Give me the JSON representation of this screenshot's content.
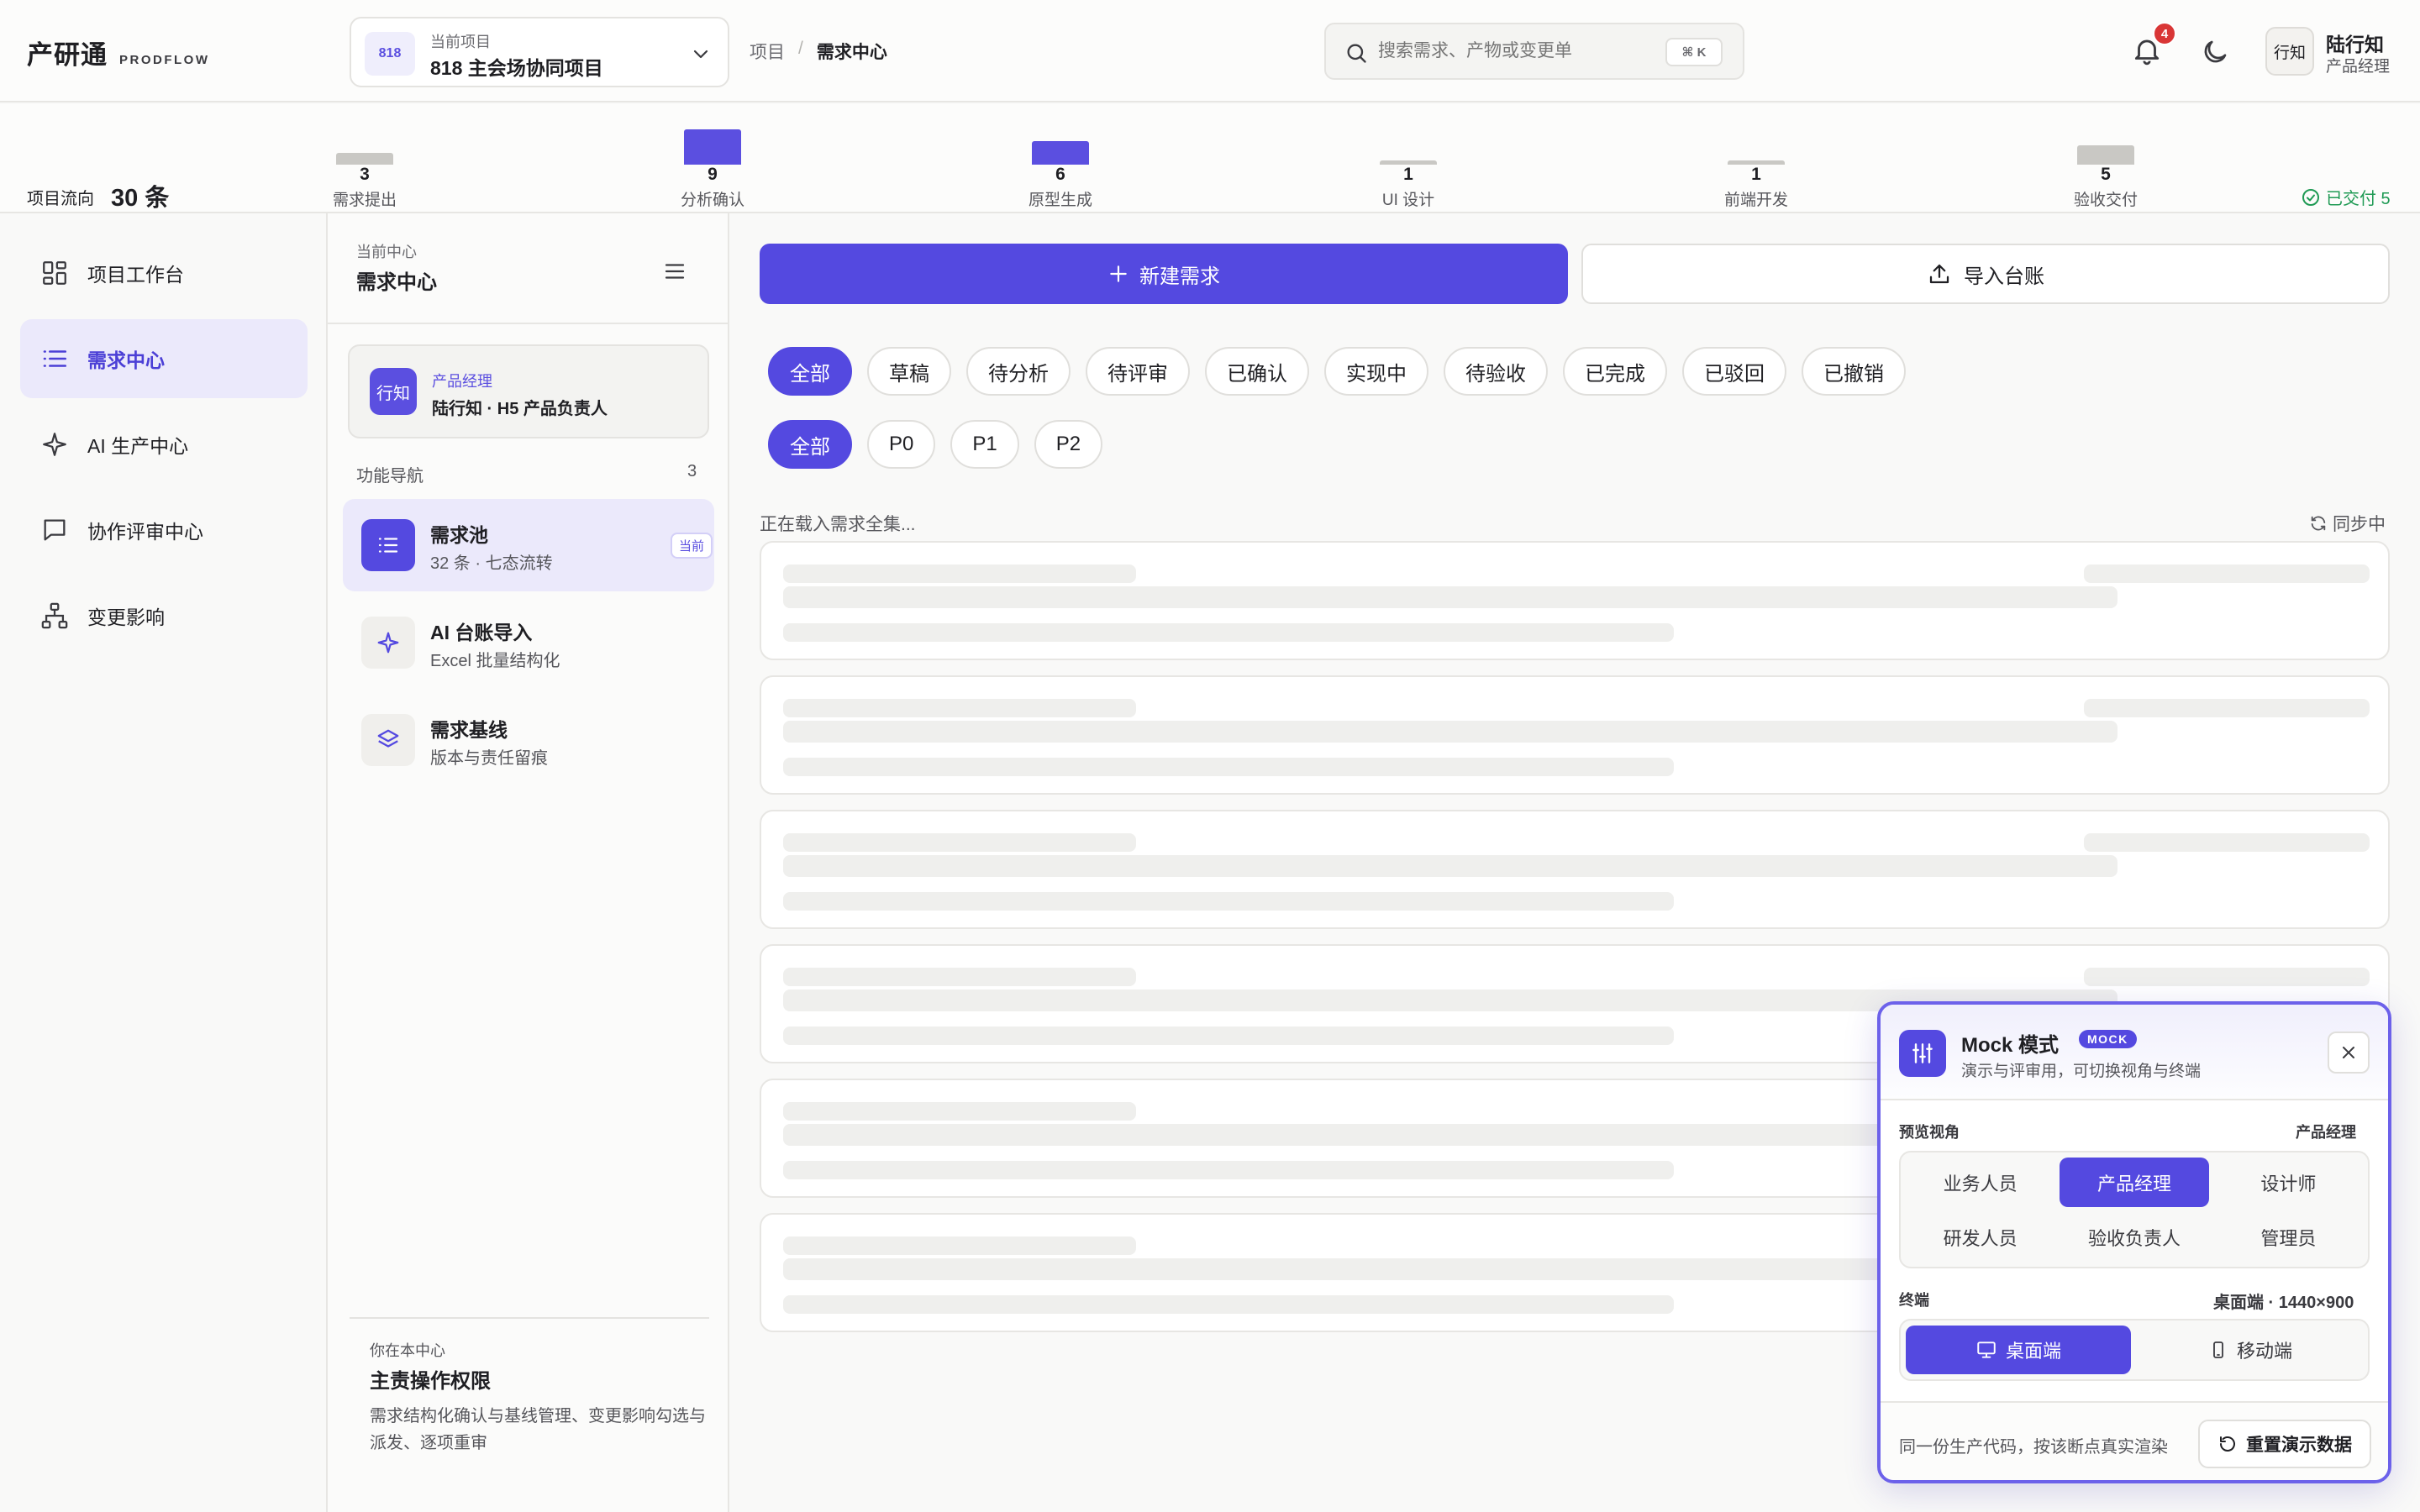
{
  "header": {
    "brand": "产研通",
    "brand_sub": "PRODFLOW",
    "project": {
      "badge": "818",
      "caption": "当前项目",
      "name": "818 主会场协同项目"
    },
    "breadcrumb": [
      "项目",
      "/",
      "需求中心"
    ],
    "search": {
      "placeholder": "搜索需求、产物或变更单",
      "shortcut": "⌘ K"
    },
    "notifications": "4",
    "user": {
      "avatar": "行知",
      "name": "陆行知",
      "role": "产品经理"
    }
  },
  "flow": {
    "label": "项目流向",
    "count": "30 条",
    "stages": [
      {
        "count": 3,
        "label": "需求提出",
        "color": "#c9c8c4"
      },
      {
        "count": 9,
        "label": "分析确认",
        "color": "#5b4fe0"
      },
      {
        "count": 6,
        "label": "原型生成",
        "color": "#5b4fe0"
      },
      {
        "count": 1,
        "label": "UI 设计",
        "color": "#c9c8c4"
      },
      {
        "count": 1,
        "label": "前端开发",
        "color": "#c9c8c4"
      },
      {
        "count": 5,
        "label": "验收交付",
        "color": "#c9c8c4"
      }
    ],
    "delivered": "已交付 5"
  },
  "sidebar": {
    "items": [
      {
        "label": "项目工作台",
        "icon": "grid-icon"
      },
      {
        "label": "需求中心",
        "icon": "list-icon"
      },
      {
        "label": "AI 生产中心",
        "icon": "sparkle-icon"
      },
      {
        "label": "协作评审中心",
        "icon": "chat-icon"
      },
      {
        "label": "变更影响",
        "icon": "hierarchy-icon"
      }
    ],
    "active": 1
  },
  "subpanel": {
    "caption": "当前中心",
    "title": "需求中心",
    "role": {
      "icon_text": "行知",
      "caption": "产品经理",
      "name": "陆行知 · H5 产品负责人"
    },
    "nav_label": "功能导航",
    "nav_count": "3",
    "items": [
      {
        "title": "需求池",
        "desc": "32 条 · 七态流转",
        "badge": "当前",
        "icon": "list-icon"
      },
      {
        "title": "AI 台账导入",
        "desc": "Excel 批量结构化",
        "icon": "sparkle-icon"
      },
      {
        "title": "需求基线",
        "desc": "版本与责任留痕",
        "icon": "layers-icon"
      }
    ],
    "perm": {
      "caption": "你在本中心",
      "title": "主责操作权限",
      "desc": "需求结构化确认与基线管理、变更影响勾选与派发、逐项重审"
    }
  },
  "main": {
    "new_button": "新建需求",
    "import_button": "导入台账",
    "status_filters": [
      "全部",
      "草稿",
      "待分析",
      "待评审",
      "已确认",
      "实现中",
      "待验收",
      "已完成",
      "已驳回",
      "已撤销"
    ],
    "priority_filters": [
      "全部",
      "P0",
      "P1",
      "P2"
    ],
    "loading": "正在载入需求全集...",
    "syncing": "同步中"
  },
  "mock": {
    "title": "Mock 模式",
    "tag": "MOCK",
    "desc": "演示与评审用，可切换视角与终端",
    "preview_label": "预览视角",
    "preview_value": "产品经理",
    "roles": [
      "业务人员",
      "产品经理",
      "设计师",
      "研发人员",
      "验收负责人",
      "管理员"
    ],
    "active_role": 1,
    "terminal_label": "终端",
    "terminal_value": "桌面端 · 1440×900",
    "terminals": [
      "桌面端",
      "移动端"
    ],
    "active_terminal": 0,
    "footer_note": "同一份生产代码，按该断点真实渲染",
    "reset_button": "重置演示数据"
  },
  "colors": {
    "accent": "#5449e0",
    "success": "#1f9a54",
    "danger": "#d93636"
  }
}
